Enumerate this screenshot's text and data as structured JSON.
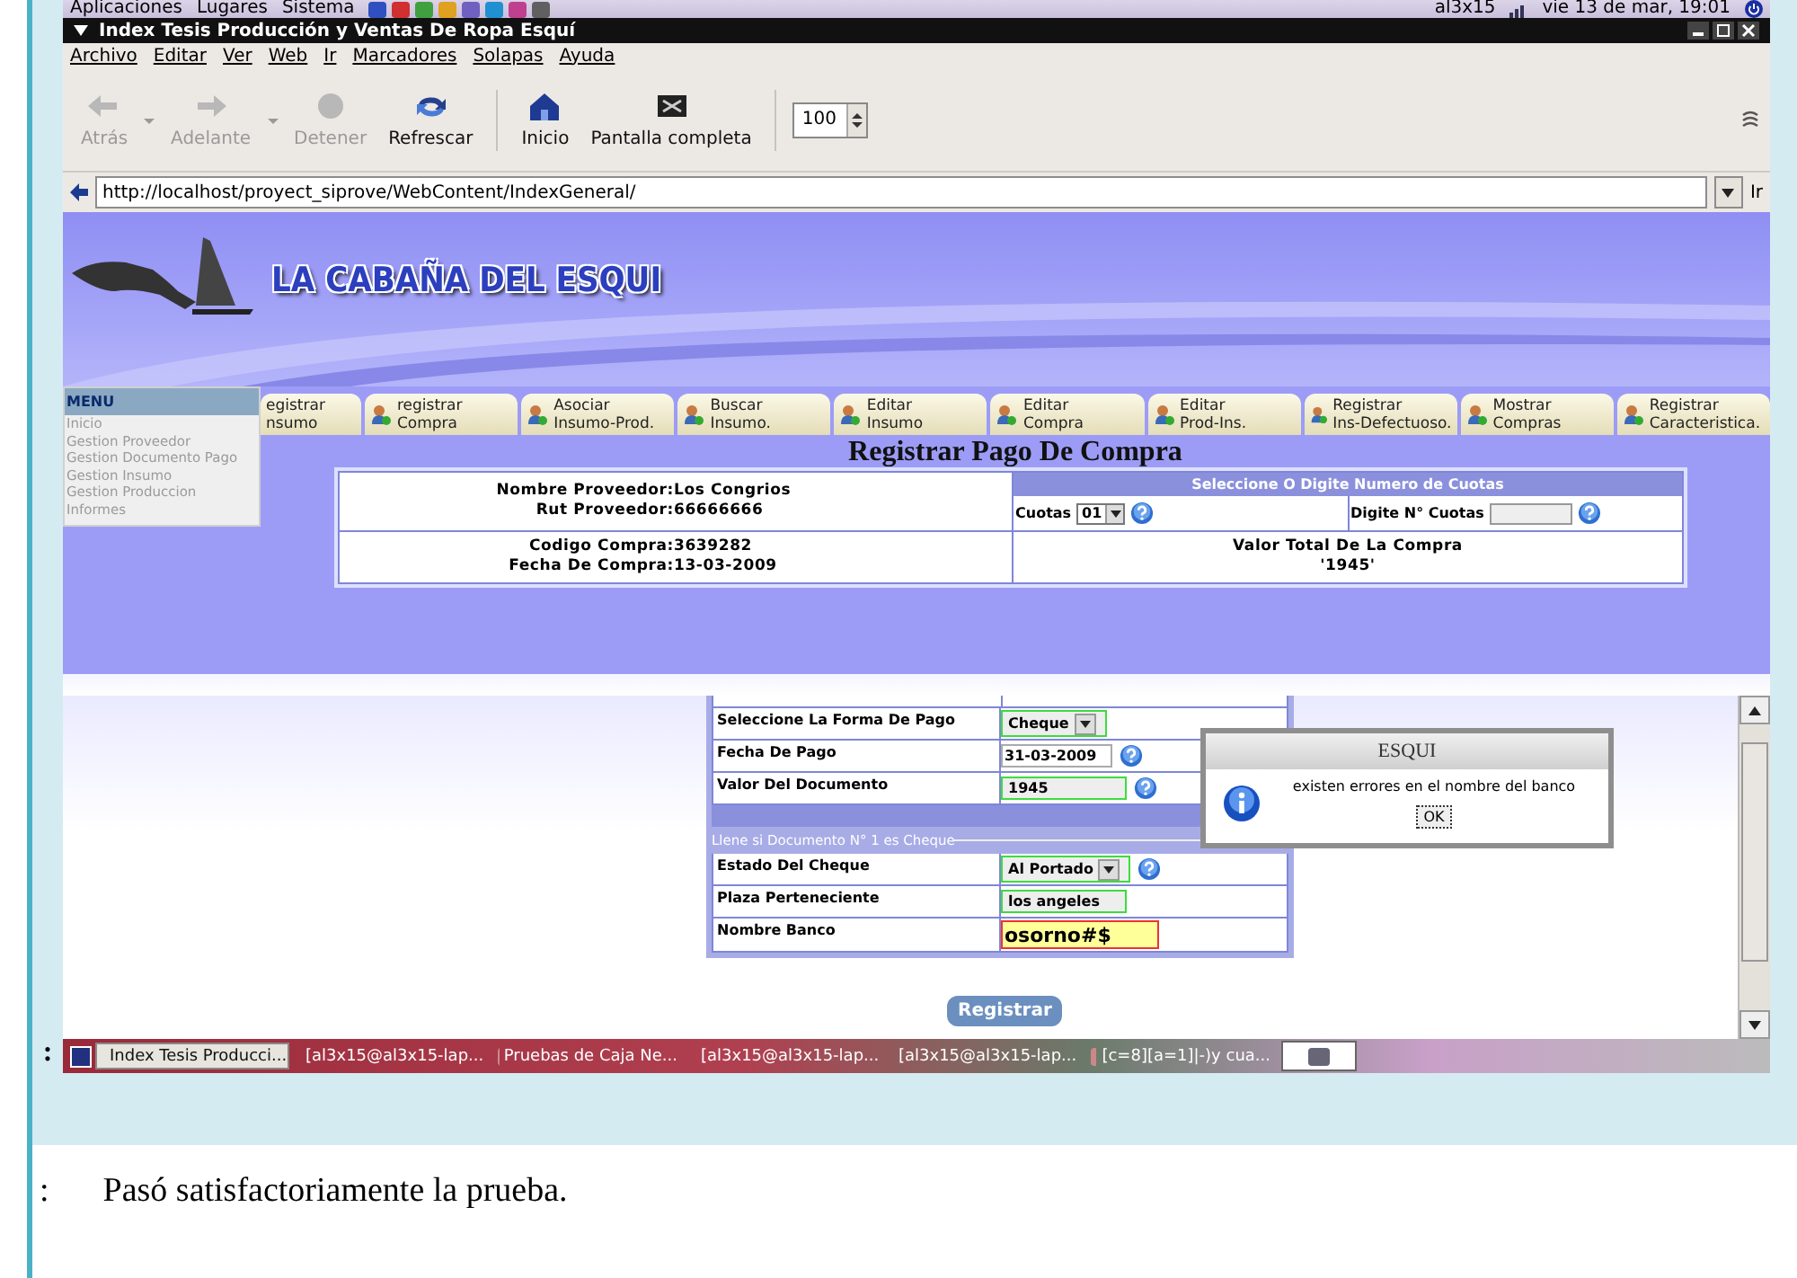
{
  "top_panel": {
    "menus": [
      "Aplicaciones",
      "Lugares",
      "Sistema"
    ],
    "user": "al3x15",
    "clock": "vie 13 de mar, 19:01"
  },
  "window": {
    "title": "Index Tesis Producción y Ventas De Ropa Esquí"
  },
  "menu_bar": [
    "Archivo",
    "Editar",
    "Ver",
    "Web",
    "Ir",
    "Marcadores",
    "Solapas",
    "Ayuda"
  ],
  "toolbar": {
    "buttons": [
      {
        "label": "Atrás",
        "kind": "back",
        "disabled": true,
        "dropdown": true
      },
      {
        "label": "Adelante",
        "kind": "forward",
        "disabled": true,
        "dropdown": true
      },
      {
        "label": "Detener",
        "kind": "stop",
        "disabled": true,
        "dropdown": false
      },
      {
        "label": "Refrescar",
        "kind": "reload",
        "disabled": false,
        "dropdown": false
      },
      {
        "label": "Inicio",
        "kind": "home",
        "disabled": false,
        "dropdown": false
      },
      {
        "label": "Pantalla completa",
        "kind": "fullscreen",
        "disabled": false,
        "dropdown": false
      }
    ],
    "zoom": "100"
  },
  "address_bar": {
    "url": "http://localhost/proyect_siprove/WebContent/IndexGeneral/",
    "go": "Ir"
  },
  "page": {
    "logo_text": "LA CABAÑA DEL ESQUI",
    "side_menu": {
      "title": "MENU",
      "items": [
        "Inicio",
        "Gestion Proveedor",
        "Gestion Documento Pago",
        "Gestion Insumo",
        "Gestion Produccion",
        "Informes"
      ]
    },
    "tabs": [
      {
        "top": "egistrar",
        "bottom": "nsumo",
        "icon": false
      },
      {
        "top": "registrar",
        "bottom": "Compra",
        "icon": true
      },
      {
        "top": "Asociar",
        "bottom": "Insumo-Prod.",
        "icon": true
      },
      {
        "top": "Buscar",
        "bottom": "Insumo.",
        "icon": true
      },
      {
        "top": "Editar",
        "bottom": "Insumo",
        "icon": true
      },
      {
        "top": "Editar",
        "bottom": "Compra",
        "icon": true
      },
      {
        "top": "Editar",
        "bottom": "Prod-Ins.",
        "icon": true
      },
      {
        "top": "Registrar",
        "bottom": "Ins-Defectuoso.",
        "icon": true
      },
      {
        "top": "Mostrar",
        "bottom": "Compras",
        "icon": true
      },
      {
        "top": "Registrar",
        "bottom": "Caracteristica.",
        "icon": true
      }
    ],
    "heading": "Registrar Pago De Compra",
    "purchase_info": [
      [
        {
          "label": "Nombre Proveedor:",
          "value": "Los Congrios"
        },
        {
          "label": "Rut Proveedor:",
          "value": "66666666"
        }
      ],
      [
        {
          "label": "Codigo Compra:",
          "value": "3639282"
        },
        {
          "label": "Fecha De Compra:",
          "value": "13-03-2009"
        }
      ]
    ],
    "installments": {
      "header": "Seleccione O Digite Numero de Cuotas",
      "cuotas_label": "Cuotas",
      "cuotas_value": "01",
      "count_label": "Digite N° Cuotas",
      "total_label": "Valor Total De La Compra",
      "total_value": "'1945'"
    },
    "payment_form": {
      "rows": [
        {
          "label": "Seleccione La Forma De Pago",
          "value": "Cheque",
          "kind": "select",
          "validated": true,
          "error": false,
          "help": false
        },
        {
          "label": "Fecha De Pago",
          "value": "31-03-2009",
          "kind": "text",
          "validated": false,
          "error": false,
          "help": true
        },
        {
          "label": "Valor Del Documento",
          "value": "1945",
          "kind": "text",
          "validated": true,
          "error": false,
          "help": true
        }
      ],
      "cheque_legend": "Llene si Documento N° 1 es Cheque",
      "cheque_rows": [
        {
          "label": "Estado Del Cheque",
          "value": "Al Portado",
          "kind": "select",
          "validated": true,
          "error": false,
          "help": true
        },
        {
          "label": "Plaza Perteneciente",
          "value": "los angeles",
          "kind": "text",
          "validated": true,
          "error": false,
          "help": false
        },
        {
          "label": "Nombre Banco",
          "value": "osorno#$",
          "kind": "text",
          "validated": false,
          "error": true,
          "help": false
        }
      ]
    },
    "submit": "Registrar",
    "dialog": {
      "title": "ESQUI",
      "message": "existen errores en el nombre del banco",
      "button": "OK"
    }
  },
  "side_marker": ":",
  "taskbar": {
    "items": [
      {
        "label": "Index Tesis Producci...",
        "selected": true
      },
      {
        "label": "[al3x15@al3x15-lap...",
        "selected": false
      },
      {
        "label": "Pruebas de Caja Ne...",
        "selected": false
      },
      {
        "label": "[al3x15@al3x15-lap...",
        "selected": false
      },
      {
        "label": "[al3x15@al3x15-lap...",
        "selected": false
      },
      {
        "label": "[c=8][a=1]|-)y cua...",
        "selected": false
      }
    ]
  },
  "caption": {
    "marker": ":",
    "text": "Pasó satisfactoriamente la prueba."
  }
}
